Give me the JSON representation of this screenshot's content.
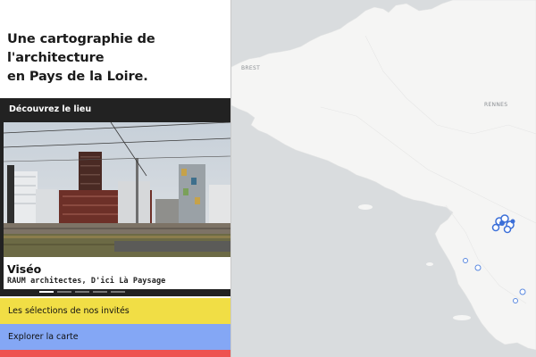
{
  "headline": {
    "line1": "Une cartographie de l'architecture",
    "line2": "en Pays de la Loire."
  },
  "discover": {
    "title": "Découvrez le lieu",
    "place_name": "Viséo",
    "authors": "RAUM architectes, D'ici Là Paysage",
    "slides_count": 5,
    "active_slide": 1
  },
  "menu": {
    "selections_label": "Les sélections de nos invités",
    "explore_label": "Explorer la carte"
  },
  "map": {
    "cities": [
      "BREST",
      "RENNES"
    ],
    "colors": {
      "sea": "#d9dcde",
      "land": "#f5f5f4",
      "marker": "#3b6fd8"
    }
  },
  "colors": {
    "card_bg": "#222222",
    "menu_yellow": "#f1de45",
    "menu_blue": "#84a7f5",
    "menu_red": "#ee5350"
  }
}
